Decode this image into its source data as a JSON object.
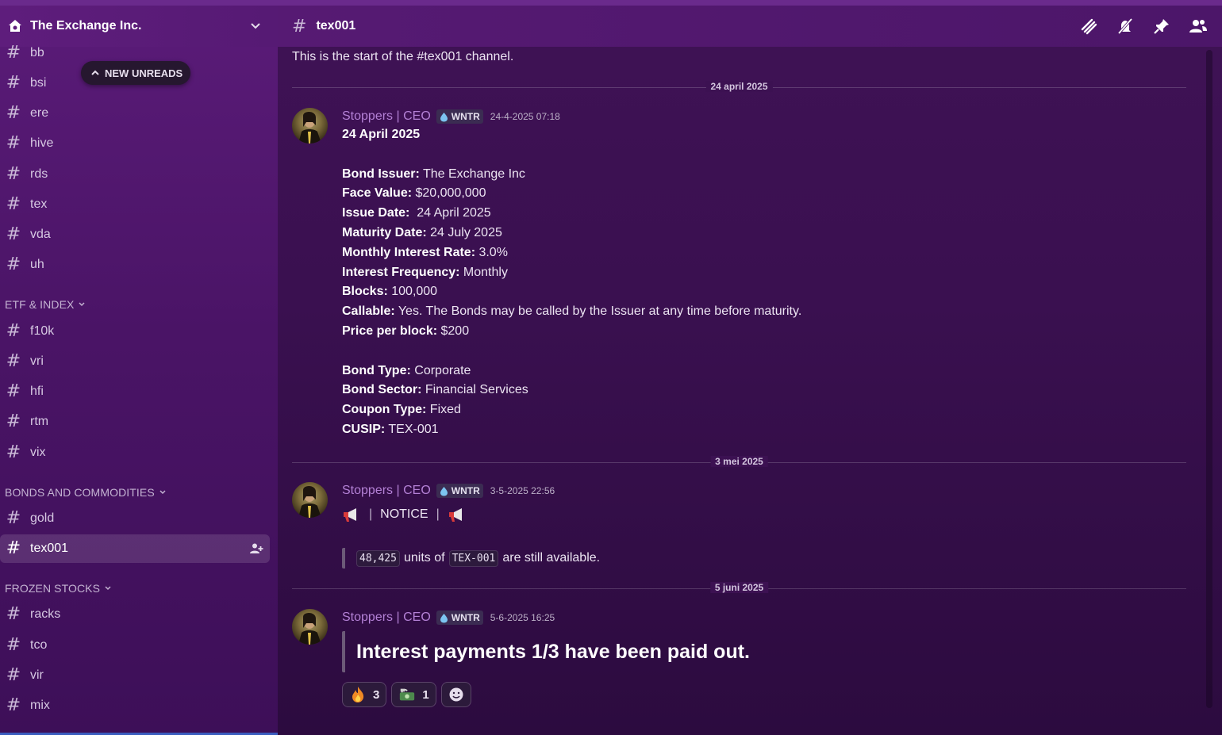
{
  "server": {
    "name": "The Exchange Inc."
  },
  "sidebar": {
    "new_unreads_label": "NEW UNREADS",
    "channels_top": [
      "bb",
      "bsi",
      "ere",
      "hive",
      "rds",
      "tex",
      "vda",
      "uh"
    ],
    "categories": [
      {
        "name": "ETF & INDEX",
        "channels": [
          "f10k",
          "vri",
          "hfi",
          "rtm",
          "vix"
        ]
      },
      {
        "name": "BONDS AND COMMODITIES",
        "channels": [
          "gold",
          "tex001"
        ]
      },
      {
        "name": "FROZEN STOCKS",
        "channels": [
          "racks",
          "tco",
          "vir",
          "mix"
        ]
      }
    ],
    "active_channel": "tex001"
  },
  "channel": {
    "name": "tex001",
    "start_text": "This is the start of the #tex001 channel."
  },
  "dividers": [
    "24 april 2025",
    "3 mei 2025",
    "5 juni 2025"
  ],
  "messages": [
    {
      "author": "Stoppers | CEO",
      "role": "WNTR",
      "timestamp": "24-4-2025 07:18",
      "heading": "24 April 2025",
      "fields": [
        {
          "label": "Bond Issuer:",
          "value": " The Exchange Inc"
        },
        {
          "label": "Face Value:",
          "value": " $20,000,000"
        },
        {
          "label": "Issue Date:",
          "value": "  24 April 2025"
        },
        {
          "label": "Maturity Date:",
          "value": " 24 July 2025"
        },
        {
          "label": "Monthly Interest Rate:",
          "value": " 3.0%"
        },
        {
          "label": "Interest Frequency:",
          "value": " Monthly"
        },
        {
          "label": "Blocks:",
          "value": " 100,000"
        },
        {
          "label": "Callable:",
          "value": " Yes. The Bonds may be called by the Issuer at any time before maturity."
        },
        {
          "label": "Price per block:",
          "value": " $200"
        }
      ],
      "fields2": [
        {
          "label": "Bond Type:",
          "value": " Corporate"
        },
        {
          "label": "Bond Sector:",
          "value": " Financial Services"
        },
        {
          "label": "Coupon Type:",
          "value": " Fixed"
        },
        {
          "label": "CUSIP:",
          "value": " TEX-001"
        }
      ]
    },
    {
      "author": "Stoppers | CEO",
      "role": "WNTR",
      "timestamp": "3-5-2025 22:56",
      "notice": "NOTICE",
      "separator": "|",
      "quote": {
        "units": "48,425",
        "middle": "units of",
        "code": "TEX-001",
        "tail": "are still available."
      }
    },
    {
      "author": "Stoppers | CEO",
      "role": "WNTR",
      "timestamp": "5-6-2025 16:25",
      "headline": "Interest payments 1/3 have been paid out.",
      "reactions": [
        {
          "emoji": "fire-icon",
          "count": "3"
        },
        {
          "emoji": "money-icon",
          "count": "1"
        }
      ]
    }
  ],
  "colors": {
    "accent": "#b481d6",
    "background": "#3a1050",
    "sidebar": "#4a1466"
  }
}
